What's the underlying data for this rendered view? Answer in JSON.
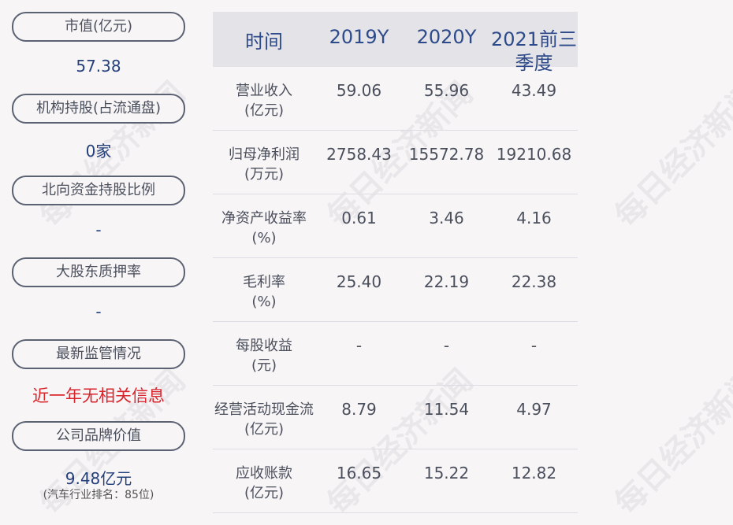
{
  "left": {
    "items": [
      {
        "label": "市值(亿元)",
        "value": "57.38"
      },
      {
        "label": "机构持股(占流通盘)",
        "value": "0家"
      },
      {
        "label": "北向资金持股比例",
        "value": "-"
      },
      {
        "label": "大股东质押率",
        "value": "-"
      },
      {
        "label": "最新监管情况",
        "value": "近一年无相关信息"
      },
      {
        "label": "公司品牌价值",
        "value": "9.48亿元",
        "note": "(汽车行业排名：85位)"
      }
    ]
  },
  "table": {
    "headers": [
      "时间",
      "2019Y",
      "2020Y",
      "2021前三季度"
    ],
    "rows": [
      {
        "label": "营业收入\n(亿元)",
        "cells": [
          "59.06",
          "55.96",
          "43.49"
        ]
      },
      {
        "label": "归母净利润\n(万元)",
        "cells": [
          "2758.43",
          "15572.78",
          "19210.68"
        ]
      },
      {
        "label": "净资产收益率\n(%)",
        "cells": [
          "0.61",
          "3.46",
          "4.16"
        ]
      },
      {
        "label": "毛利率\n(%)",
        "cells": [
          "25.40",
          "22.19",
          "22.38"
        ]
      },
      {
        "label": "每股收益\n(元)",
        "cells": [
          "-",
          "-",
          "-"
        ]
      },
      {
        "label": "经营活动现金流\n(亿元)",
        "cells": [
          "8.79",
          "11.54",
          "4.97"
        ]
      },
      {
        "label": "应收账款\n(亿元)",
        "cells": [
          "16.65",
          "15.22",
          "12.82"
        ]
      }
    ]
  },
  "watermark": "每日经济新闻"
}
